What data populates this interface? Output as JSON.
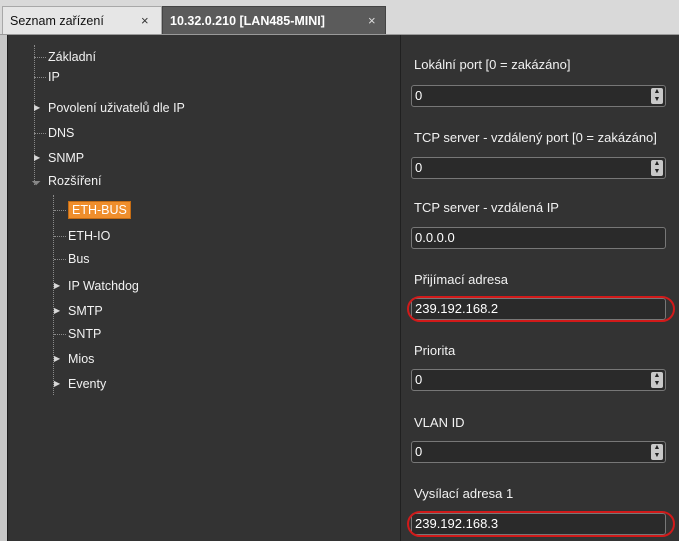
{
  "tabs": [
    {
      "label": "Seznam zařízení",
      "close": "×"
    },
    {
      "label": "10.32.0.210 [LAN485-MINI]",
      "close": "×"
    }
  ],
  "tree": {
    "items": [
      {
        "label": "Základní"
      },
      {
        "label": "IP"
      },
      {
        "label": "Povolení uživatelů dle IP"
      },
      {
        "label": "DNS"
      },
      {
        "label": "SNMP"
      },
      {
        "label": "Rozšíření"
      },
      {
        "label": "ETH-BUS",
        "selected": true
      },
      {
        "label": "ETH-IO"
      },
      {
        "label": "Bus"
      },
      {
        "label": "IP Watchdog"
      },
      {
        "label": "SMTP"
      },
      {
        "label": "SNTP"
      },
      {
        "label": "Mios"
      },
      {
        "label": "Eventy"
      }
    ]
  },
  "properties": [
    {
      "label": "Lokální port [0 = zakázáno]",
      "value": "0"
    },
    {
      "label": "TCP server - vzdálený port [0 = zakázáno]",
      "value": "0"
    },
    {
      "label": "TCP server - vzdálená IP",
      "value": "0.0.0.0"
    },
    {
      "label": "Přijímací adresa",
      "value": "239.192.168.2"
    },
    {
      "label": "Priorita",
      "value": "0"
    },
    {
      "label": "VLAN ID",
      "value": "0"
    },
    {
      "label": "Vysílací adresa 1",
      "value": "239.192.168.3"
    }
  ],
  "colors": {
    "selection": "#ef8e2c",
    "highlight_ring": "#d11a1a",
    "panel_bg": "#333333"
  },
  "icons": {
    "spin": "spinner-updown-icon",
    "expand": "triangle-right-icon"
  }
}
